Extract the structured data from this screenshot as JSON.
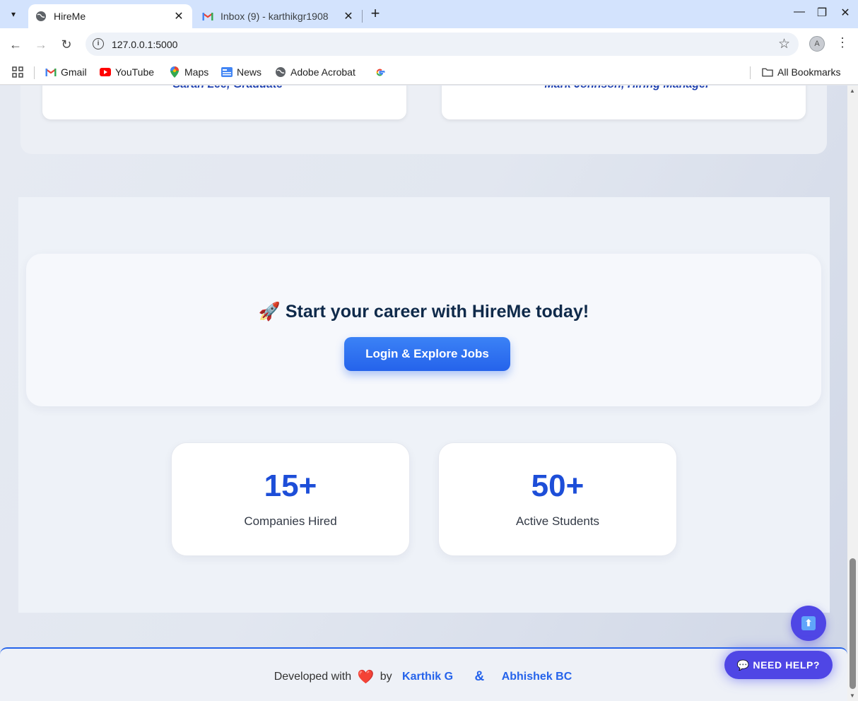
{
  "browser": {
    "tabs": [
      {
        "title": "HireMe",
        "active": true
      },
      {
        "title": "Inbox (9) - karthikgr1908",
        "active": false
      }
    ],
    "url": "127.0.0.1:5000",
    "bookmarks": [
      "Gmail",
      "YouTube",
      "Maps",
      "News",
      "Adobe Acrobat"
    ],
    "all_bookmarks": "All Bookmarks"
  },
  "testimonials": {
    "authors": [
      "- Sarah Lee, Graduate",
      "- Mark Johnson, Hiring Manager"
    ]
  },
  "cta": {
    "title": "🚀 Start your career with HireMe today!",
    "button": "Login & Explore Jobs"
  },
  "stats": [
    {
      "value": "15+",
      "label": "Companies Hired"
    },
    {
      "value": "50+",
      "label": "Active Students"
    }
  ],
  "footer": {
    "prefix": "Developed with",
    "heart": "❤️",
    "by": "by",
    "author1": "Karthik G",
    "amp": "&",
    "author2": "Abhishek BC"
  },
  "help_button": "💬 NEED HELP?",
  "scroll_top_icon": "⬆",
  "colors": {
    "accent": "#2563eb",
    "brand_dark": "#0f2a4a",
    "help_bg": "#4f46e5"
  }
}
